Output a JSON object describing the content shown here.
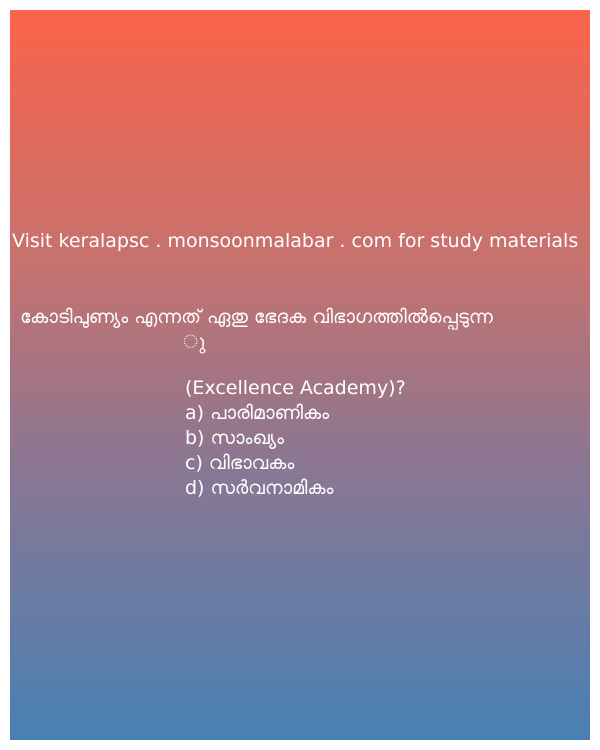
{
  "card": {
    "promo_text": "Visit keralapsc . monsoonmalabar . com for study materials",
    "question_line1": "കോടിപുണ്യം എന്നത് ഏതു ഭേദക വിഭാഗത്തിൽപ്പെടുന്ന",
    "question_line2": "ു",
    "source": "(Excellence Academy)?",
    "options": [
      "a) പാരിമാണികം",
      "b) സാംഖ്യം",
      "c) വിഭാവകം",
      "d) സർവനാമികം"
    ]
  },
  "colors": {
    "gradient_top": "#fb634a",
    "gradient_bottom": "#4880b4",
    "text": "#ffffff"
  }
}
